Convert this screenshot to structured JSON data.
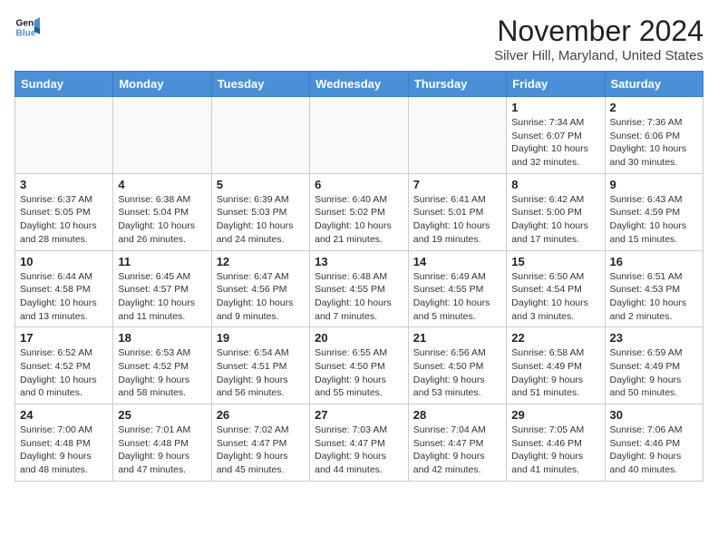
{
  "header": {
    "logo_line1": "General",
    "logo_line2": "Blue",
    "month": "November 2024",
    "location": "Silver Hill, Maryland, United States"
  },
  "weekdays": [
    "Sunday",
    "Monday",
    "Tuesday",
    "Wednesday",
    "Thursday",
    "Friday",
    "Saturday"
  ],
  "rows": [
    [
      {
        "day": "",
        "info": ""
      },
      {
        "day": "",
        "info": ""
      },
      {
        "day": "",
        "info": ""
      },
      {
        "day": "",
        "info": ""
      },
      {
        "day": "",
        "info": ""
      },
      {
        "day": "1",
        "info": "Sunrise: 7:34 AM\nSunset: 6:07 PM\nDaylight: 10 hours\nand 32 minutes."
      },
      {
        "day": "2",
        "info": "Sunrise: 7:36 AM\nSunset: 6:06 PM\nDaylight: 10 hours\nand 30 minutes."
      }
    ],
    [
      {
        "day": "3",
        "info": "Sunrise: 6:37 AM\nSunset: 5:05 PM\nDaylight: 10 hours\nand 28 minutes."
      },
      {
        "day": "4",
        "info": "Sunrise: 6:38 AM\nSunset: 5:04 PM\nDaylight: 10 hours\nand 26 minutes."
      },
      {
        "day": "5",
        "info": "Sunrise: 6:39 AM\nSunset: 5:03 PM\nDaylight: 10 hours\nand 24 minutes."
      },
      {
        "day": "6",
        "info": "Sunrise: 6:40 AM\nSunset: 5:02 PM\nDaylight: 10 hours\nand 21 minutes."
      },
      {
        "day": "7",
        "info": "Sunrise: 6:41 AM\nSunset: 5:01 PM\nDaylight: 10 hours\nand 19 minutes."
      },
      {
        "day": "8",
        "info": "Sunrise: 6:42 AM\nSunset: 5:00 PM\nDaylight: 10 hours\nand 17 minutes."
      },
      {
        "day": "9",
        "info": "Sunrise: 6:43 AM\nSunset: 4:59 PM\nDaylight: 10 hours\nand 15 minutes."
      }
    ],
    [
      {
        "day": "10",
        "info": "Sunrise: 6:44 AM\nSunset: 4:58 PM\nDaylight: 10 hours\nand 13 minutes."
      },
      {
        "day": "11",
        "info": "Sunrise: 6:45 AM\nSunset: 4:57 PM\nDaylight: 10 hours\nand 11 minutes."
      },
      {
        "day": "12",
        "info": "Sunrise: 6:47 AM\nSunset: 4:56 PM\nDaylight: 10 hours\nand 9 minutes."
      },
      {
        "day": "13",
        "info": "Sunrise: 6:48 AM\nSunset: 4:55 PM\nDaylight: 10 hours\nand 7 minutes."
      },
      {
        "day": "14",
        "info": "Sunrise: 6:49 AM\nSunset: 4:55 PM\nDaylight: 10 hours\nand 5 minutes."
      },
      {
        "day": "15",
        "info": "Sunrise: 6:50 AM\nSunset: 4:54 PM\nDaylight: 10 hours\nand 3 minutes."
      },
      {
        "day": "16",
        "info": "Sunrise: 6:51 AM\nSunset: 4:53 PM\nDaylight: 10 hours\nand 2 minutes."
      }
    ],
    [
      {
        "day": "17",
        "info": "Sunrise: 6:52 AM\nSunset: 4:52 PM\nDaylight: 10 hours\nand 0 minutes."
      },
      {
        "day": "18",
        "info": "Sunrise: 6:53 AM\nSunset: 4:52 PM\nDaylight: 9 hours\nand 58 minutes."
      },
      {
        "day": "19",
        "info": "Sunrise: 6:54 AM\nSunset: 4:51 PM\nDaylight: 9 hours\nand 56 minutes."
      },
      {
        "day": "20",
        "info": "Sunrise: 6:55 AM\nSunset: 4:50 PM\nDaylight: 9 hours\nand 55 minutes."
      },
      {
        "day": "21",
        "info": "Sunrise: 6:56 AM\nSunset: 4:50 PM\nDaylight: 9 hours\nand 53 minutes."
      },
      {
        "day": "22",
        "info": "Sunrise: 6:58 AM\nSunset: 4:49 PM\nDaylight: 9 hours\nand 51 minutes."
      },
      {
        "day": "23",
        "info": "Sunrise: 6:59 AM\nSunset: 4:49 PM\nDaylight: 9 hours\nand 50 minutes."
      }
    ],
    [
      {
        "day": "24",
        "info": "Sunrise: 7:00 AM\nSunset: 4:48 PM\nDaylight: 9 hours\nand 48 minutes."
      },
      {
        "day": "25",
        "info": "Sunrise: 7:01 AM\nSunset: 4:48 PM\nDaylight: 9 hours\nand 47 minutes."
      },
      {
        "day": "26",
        "info": "Sunrise: 7:02 AM\nSunset: 4:47 PM\nDaylight: 9 hours\nand 45 minutes."
      },
      {
        "day": "27",
        "info": "Sunrise: 7:03 AM\nSunset: 4:47 PM\nDaylight: 9 hours\nand 44 minutes."
      },
      {
        "day": "28",
        "info": "Sunrise: 7:04 AM\nSunset: 4:47 PM\nDaylight: 9 hours\nand 42 minutes."
      },
      {
        "day": "29",
        "info": "Sunrise: 7:05 AM\nSunset: 4:46 PM\nDaylight: 9 hours\nand 41 minutes."
      },
      {
        "day": "30",
        "info": "Sunrise: 7:06 AM\nSunset: 4:46 PM\nDaylight: 9 hours\nand 40 minutes."
      }
    ]
  ]
}
